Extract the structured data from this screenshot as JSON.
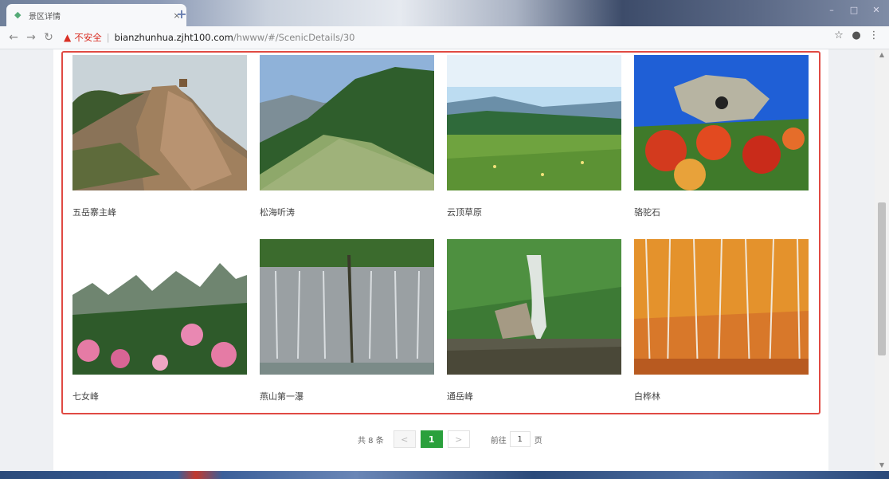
{
  "browser": {
    "tab_title": "景区详情",
    "tab_close": "×",
    "new_tab": "+",
    "security_label": "不安全",
    "url_host": "bianzhunhua.zjht100.com",
    "url_path": "/hwww/#/ScenicDetails/30"
  },
  "gallery": {
    "items": [
      {
        "caption": "五岳寨主峰"
      },
      {
        "caption": "松海听涛"
      },
      {
        "caption": "云顶草原"
      },
      {
        "caption": "骆驼石"
      },
      {
        "caption": "七女峰"
      },
      {
        "caption": "燕山第一瀑"
      },
      {
        "caption": "通岳峰"
      },
      {
        "caption": "白桦林"
      }
    ]
  },
  "pagination": {
    "total_text": "共 8 条",
    "prev": "<",
    "current_page": "1",
    "next": ">",
    "goto_label": "前往",
    "goto_value": "1",
    "goto_unit": "页"
  },
  "colors": {
    "highlight_border": "#e04a43",
    "active_page": "#2aa03c",
    "insecure": "#d93025"
  }
}
